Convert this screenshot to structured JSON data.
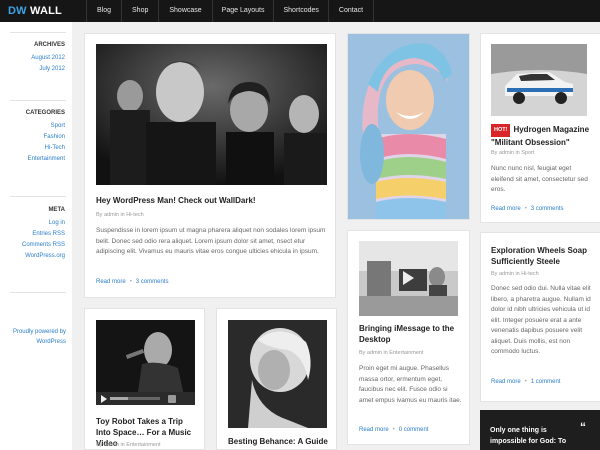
{
  "header": {
    "logo_prefix": "DW",
    "logo_suffix": "WALL",
    "nav": [
      "Blog",
      "Shop",
      "Showcase",
      "Page Layouts",
      "Shortcodes",
      "Contact"
    ]
  },
  "sidebar": {
    "archives": {
      "heading": "ARCHIVES",
      "links": [
        "August 2012",
        "July 2012"
      ]
    },
    "categories": {
      "heading": "CATEGORIES",
      "links": [
        "Sport",
        "Fashion",
        "Hi-Tech",
        "Entertainment"
      ]
    },
    "meta": {
      "heading": "META",
      "links": [
        "Log in",
        "Entries RSS",
        "Comments RSS",
        "WordPress.org"
      ]
    },
    "powered": "Proudly powered by WordPress"
  },
  "posts": {
    "featured": {
      "title": "Hey WordPress Man! Check out WallDark!",
      "meta": "By admin in Hi-tech",
      "excerpt": "Suspendisse in lorem ipsum ut magna pharera aliquet non sodales lorem ipsum belit. Donec sed odio rera aliquet. Lorem ipsum dolor sit amet, nsect etur adipiscing elit. Vivamus eu mauris vitae eros congue ulticies ehicula in ipsum.",
      "read_more": "Read more",
      "comments": "3 comments"
    },
    "woman_image_alt": "",
    "imessage": {
      "title": "Bringing iMessage to the Desktop",
      "meta": "By admin in Entertainment",
      "excerpt": "Proin eget mi augue. Phasellus massa ortor, ermentum eget, faucibus nec elit. Fusce odio si amet empus ivamus eu mauris itae.",
      "read_more": "Read more",
      "comments": "0 comment"
    },
    "hydrogen": {
      "badge": "HOT!",
      "title": "Hydrogen Magazine \"Militant Obsession\"",
      "meta": "By admin in Sport",
      "excerpt": "Nunc nunc nisl, feugiat eget eleifend sit amet, consectetur sed eros.",
      "read_more": "Read more",
      "comments": "3 comments"
    },
    "exploration": {
      "title": "Exploration Wheels Soap Sufficiently Steele",
      "meta": "By admin in Hi-tech",
      "excerpt": "Donec sed odio dui. Nulla vitae elit libero, a pharetra augue. Nullam id dolor id nibh ultricies vehicula ut id elit. Integer posuere erat a ante venenatis dapibus posuere velit aliquet. Duis mollis, est non commodo luctus.",
      "read_more": "Read more",
      "comments": "1 comment"
    },
    "toy_robot": {
      "title": "Toy Robot Takes a Trip Into Space… For a Music Video",
      "meta": "By admin in Entertainment"
    },
    "besting": {
      "title": "Besting Behance: A Guide to Creative Networking"
    },
    "quote": {
      "text": "Only one thing is impossible for God: To",
      "mark": "“"
    }
  },
  "colors": {
    "accent": "#2a7ec9",
    "topbar": "#161616",
    "hot": "#d9252a"
  }
}
